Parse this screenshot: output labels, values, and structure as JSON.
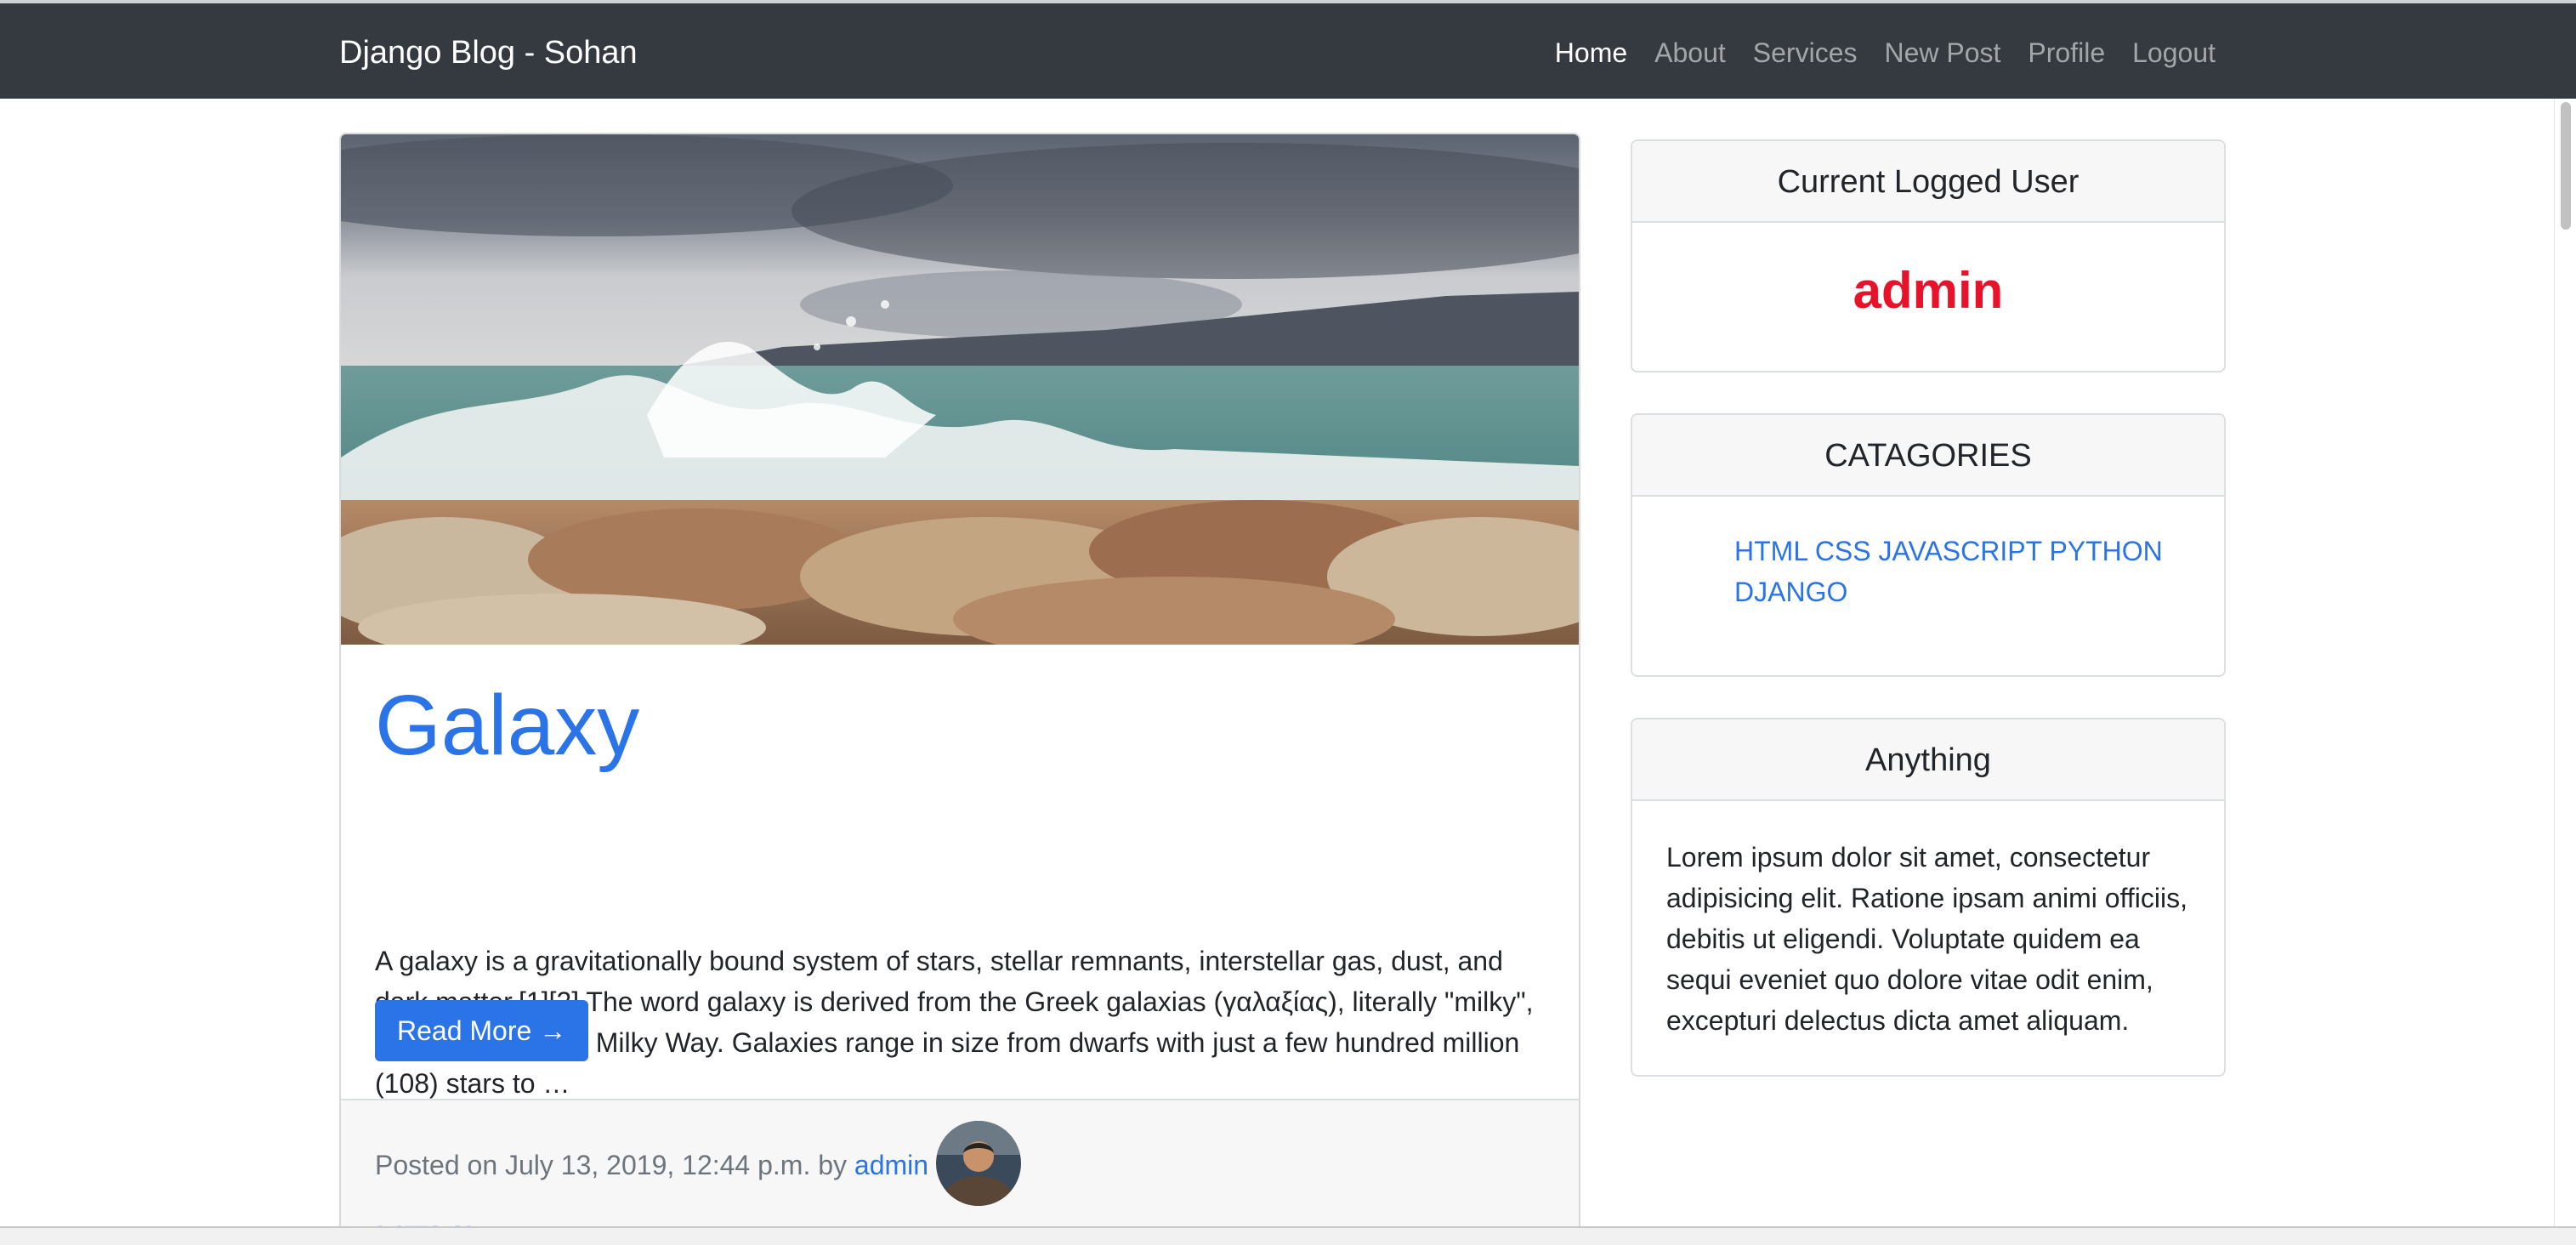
{
  "navbar": {
    "brand": "Django Blog - Sohan",
    "links": [
      {
        "label": "Home"
      },
      {
        "label": "About"
      },
      {
        "label": "Services"
      },
      {
        "label": "New Post"
      },
      {
        "label": "Profile"
      },
      {
        "label": "Logout"
      }
    ]
  },
  "post": {
    "title": "Galaxy",
    "excerpt": "A galaxy is a gravitationally bound system of stars, stellar remnants, interstellar gas, dust, and dark matter.[1][2] The word galaxy is derived from the Greek galaxias (γαλαξίας), literally \"milky\", a reference to the Milky Way. Galaxies range in size from dwarfs with just a few hundred million (108) stars to …",
    "read_more": "Read More →",
    "meta_prefix": "Posted on July 13, 2019, 12:44 p.m. by ",
    "author": "admin",
    "next_title": "HTML"
  },
  "sidebar": {
    "user_card": {
      "heading": "Current Logged User",
      "username": "admin"
    },
    "categories_card": {
      "heading": "CATAGORIES",
      "items": [
        "HTML",
        "CSS",
        "JAVASCRIPT",
        "PYTHON",
        "DJANGO"
      ]
    },
    "anything_card": {
      "heading": "Anything",
      "text": "Lorem ipsum dolor sit amet, consectetur adipisicing elit. Ratione ipsam animi officiis, debitis ut eligendi. Voluptate quidem ea sequi eveniet quo dolore vitae odit enim, excepturi delectus dicta amet aliquam."
    }
  },
  "colors": {
    "navbar_bg": "#343a40",
    "link": "#2a74e7",
    "username": "#e8132b",
    "primary_button": "#2a74e7"
  }
}
